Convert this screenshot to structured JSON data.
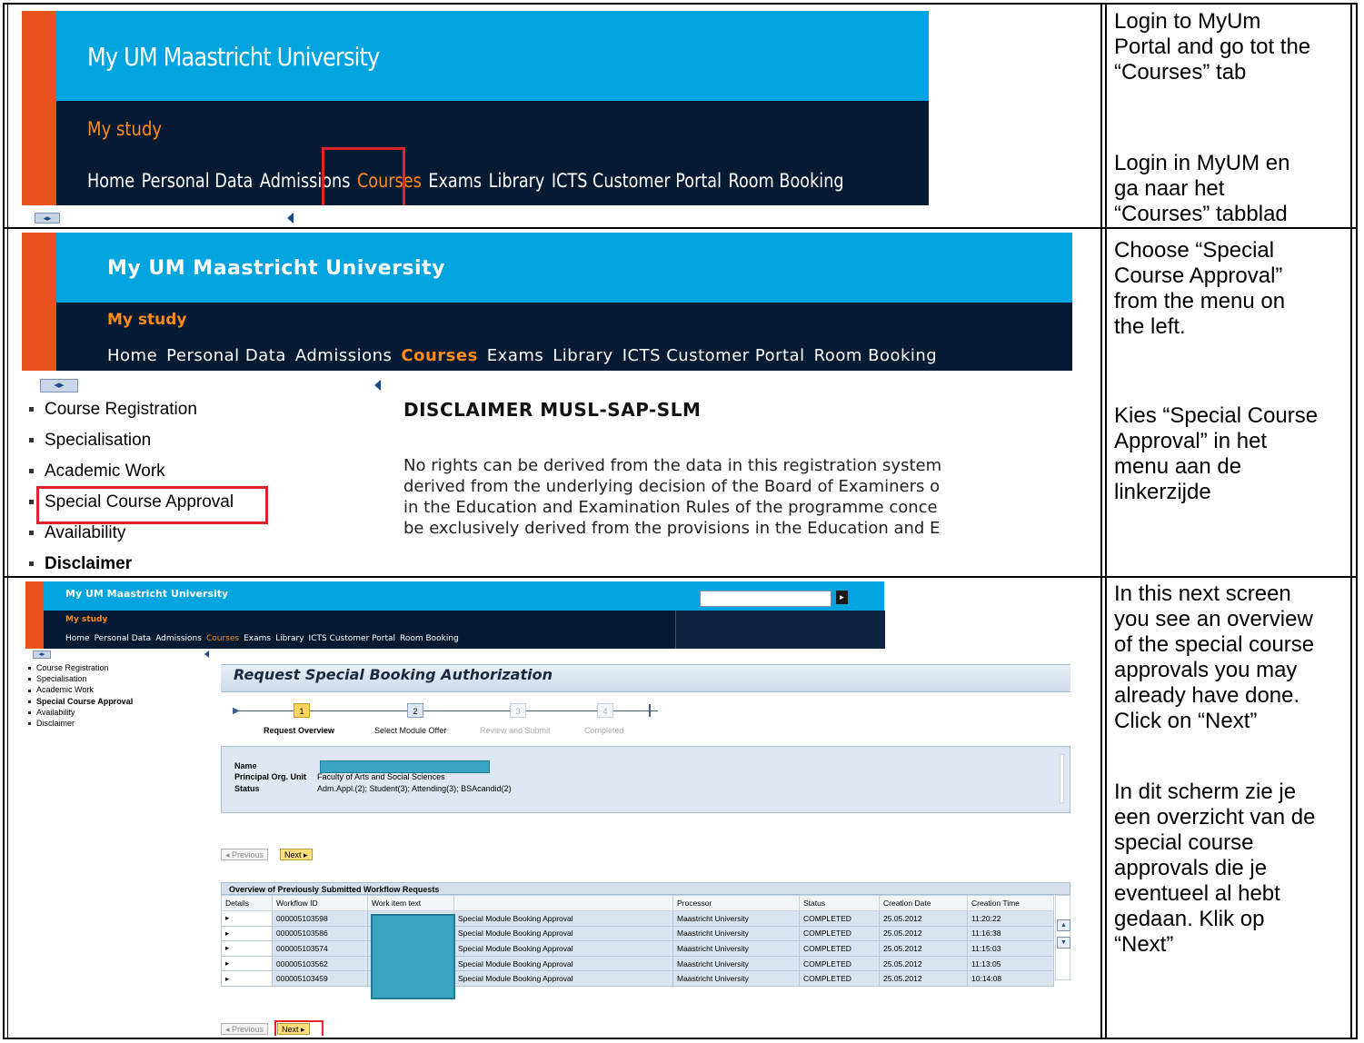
{
  "instructions": [
    {
      "en": [
        "Login to MyUm",
        "Portal and go tot the",
        "“Courses” tab"
      ],
      "nl": [
        "Login in MyUM en",
        "ga naar het",
        "“Courses” tabblad"
      ]
    },
    {
      "en": [
        "Choose “Special",
        "Course Approval”",
        "from the menu on",
        "the left."
      ],
      "nl": [
        "Kies “Special Course",
        "Approval” in het",
        "menu aan de",
        "linkerzijde"
      ]
    },
    {
      "en": [
        "In this next screen",
        "you see an overview",
        "of the special course",
        "approvals you may",
        "already have done.",
        "Click on “Next”"
      ],
      "nl": [
        "In dit scherm zie je",
        "een overzicht van de",
        "special course",
        "approvals die je",
        "eventueel al hebt",
        "gedaan. Klik op",
        "“Next”"
      ]
    }
  ],
  "portal": {
    "title": "My UM Maastricht University",
    "section": "My study",
    "nav": [
      "Home",
      "Personal Data",
      "Admissions",
      "Courses",
      "Exams",
      "Library",
      "ICTS Customer Portal",
      "Room Booking"
    ],
    "active_nav": "Courses"
  },
  "menu": [
    "Course Registration",
    "Specialisation",
    "Academic Work",
    "Special Course Approval",
    "Availability",
    "Disclaimer"
  ],
  "disclaimer": {
    "heading": "DISCLAIMER MUSL-SAP-SLM",
    "lines": [
      "No rights can be derived from the data in this registration system",
      "derived from the underlying decision of the Board of Examiners o",
      "in the Education and Examination Rules of the programme conce",
      "be exclusively derived from the provisions in the Education and E"
    ]
  },
  "request": {
    "title": "Request Special Booking Authorization",
    "steps": [
      {
        "num": "1",
        "label": "Request Overview",
        "state": "current"
      },
      {
        "num": "2",
        "label": "Select Module Offer",
        "state": "next"
      },
      {
        "num": "3",
        "label": "Review and Submit",
        "state": "disabled"
      },
      {
        "num": "4",
        "label": "Completed",
        "state": "disabled"
      }
    ],
    "info": {
      "name_label": "Name",
      "org_label": "Principal Org. Unit",
      "org_value": "Faculty of Arts and Social Sciences",
      "status_label": "Status",
      "status_value": "Adm.Appl.(2); Student(3); Attending(3); BSAcandid(2)"
    },
    "prev_label": "Previous",
    "next_label": "Next",
    "grid_title": "Overview of Previously Submitted Workflow Requests",
    "columns": [
      "Details",
      "Workflow ID",
      "Work item text",
      "",
      "Processor",
      "Status",
      "Creation Date",
      "Creation Time"
    ],
    "rows": [
      [
        "▸",
        "000005103598",
        "",
        "Special Module Booking Approval",
        "Maastricht University",
        "COMPLETED",
        "25.05.2012",
        "11:20:22"
      ],
      [
        "▸",
        "000005103586",
        "",
        "Special Module Booking Approval",
        "Maastricht University",
        "COMPLETED",
        "25.05.2012",
        "11:16:38"
      ],
      [
        "▸",
        "000005103574",
        "",
        "Special Module Booking Approval",
        "Maastricht University",
        "COMPLETED",
        "25.05.2012",
        "11:15:03"
      ],
      [
        "▸",
        "000005103562",
        "",
        "Special Module Booking Approval",
        "Maastricht University",
        "COMPLETED",
        "25.05.2012",
        "11:13:05"
      ],
      [
        "▸",
        "000005103459",
        "",
        "Special Module Booking Approval",
        "Maastricht University",
        "COMPLETED",
        "25.05.2012",
        "10:14:08"
      ]
    ]
  },
  "colors": {
    "accent_orange": "#e8521e",
    "header_blue": "#00a5df",
    "header_dark": "#061a33",
    "active_nav": "#ff8c1a",
    "highlight_red": "#e0242a"
  }
}
